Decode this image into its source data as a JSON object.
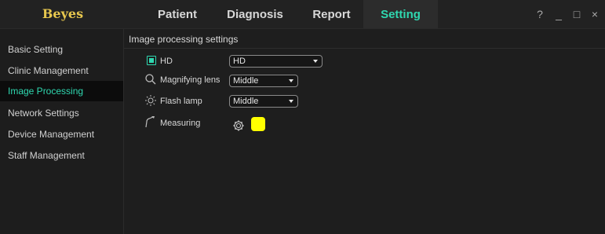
{
  "app": {
    "brand": "Beyes"
  },
  "nav": {
    "items": [
      "Patient",
      "Diagnosis",
      "Report",
      "Setting"
    ],
    "active": "Setting"
  },
  "window_controls": {
    "help": "?",
    "minimize": "_",
    "maximize": "□",
    "close": "×"
  },
  "sidebar": {
    "items": [
      {
        "label": "Basic Setting"
      },
      {
        "label": "Clinic Management"
      },
      {
        "label": "Image Processing",
        "active": true
      },
      {
        "label": "Network Settings"
      },
      {
        "label": "Device Management"
      },
      {
        "label": "Staff Management"
      }
    ]
  },
  "main": {
    "title": "Image processing settings",
    "hd": {
      "label": "HD",
      "checked": true,
      "select_value": "HD"
    },
    "magnify": {
      "label": "Magnifying lens",
      "select_value": "Middle"
    },
    "flash": {
      "label": "Flash lamp",
      "select_value": "Middle"
    },
    "measuring": {
      "label": "Measuring",
      "color": "#ffff00"
    }
  },
  "colors": {
    "accent": "#2fd8b0",
    "brand": "#e7c74e",
    "measuring_swatch": "#ffff00"
  }
}
